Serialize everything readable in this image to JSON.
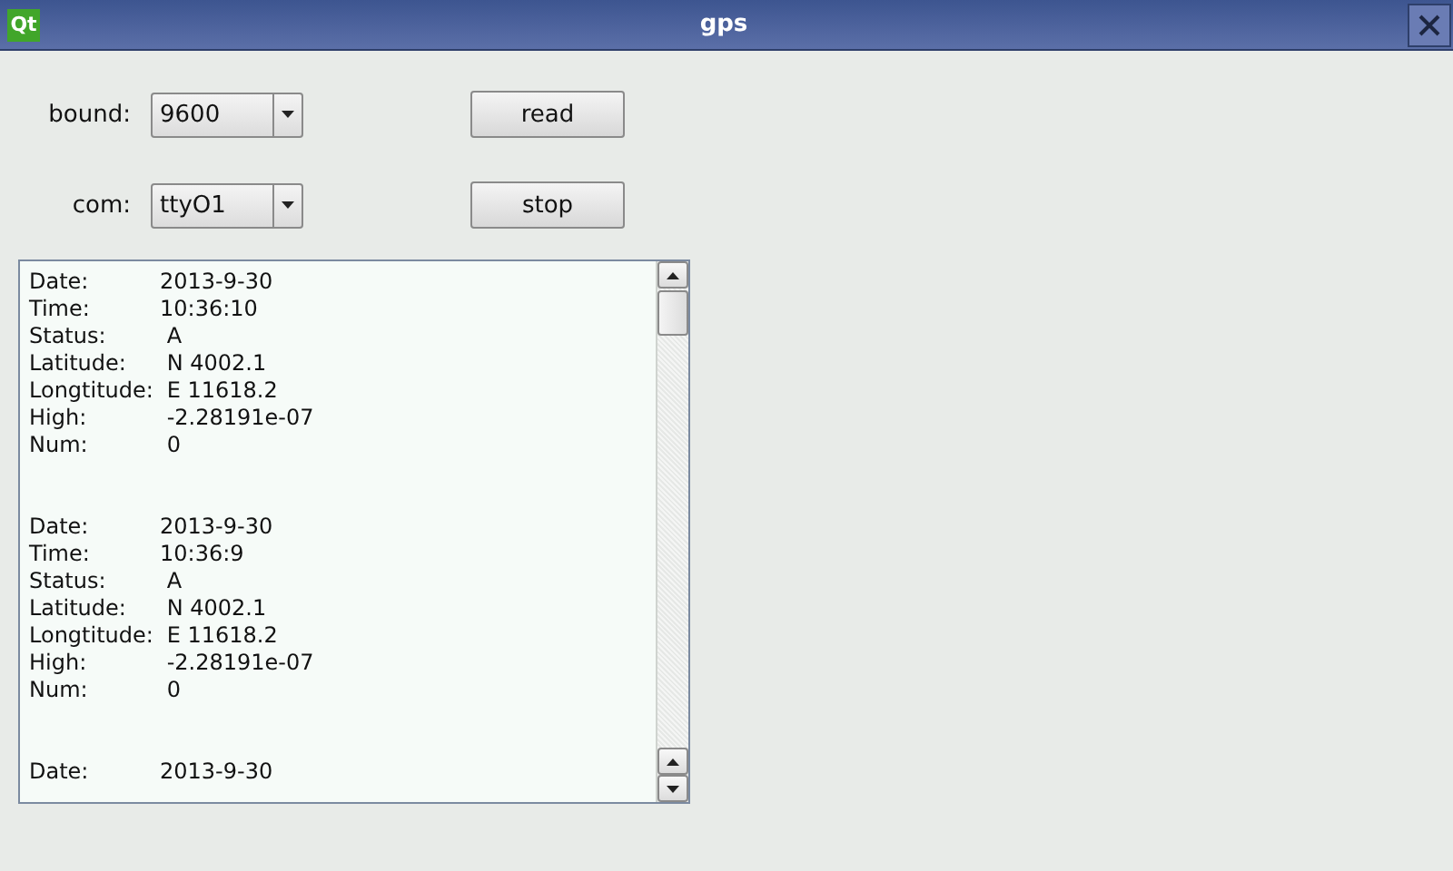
{
  "window": {
    "logo": "Qt",
    "title": "gps"
  },
  "controls": [
    {
      "label": "bound:",
      "value": "9600",
      "button": "read"
    },
    {
      "label": "com:",
      "value": "ttyO1",
      "button": "stop"
    }
  ],
  "log": [
    [
      {
        "label": "Date:",
        "value": "2013-9-30"
      },
      {
        "label": "Time:",
        "value": "10:36:10"
      },
      {
        "label": "Status:",
        "value": " A"
      },
      {
        "label": "Latitude:",
        "value": " N 4002.1"
      },
      {
        "label": "Longtitude:",
        "value": " E 11618.2"
      },
      {
        "label": "High:",
        "value": " -2.28191e-07"
      },
      {
        "label": "Num:",
        "value": " 0"
      }
    ],
    [
      {
        "label": "Date:",
        "value": "2013-9-30"
      },
      {
        "label": "Time:",
        "value": "10:36:9"
      },
      {
        "label": "Status:",
        "value": " A"
      },
      {
        "label": "Latitude:",
        "value": " N 4002.1"
      },
      {
        "label": "Longtitude:",
        "value": " E 11618.2"
      },
      {
        "label": "High:",
        "value": " -2.28191e-07"
      },
      {
        "label": "Num:",
        "value": " 0"
      }
    ],
    [
      {
        "label": "Date:",
        "value": "2013-9-30"
      }
    ]
  ]
}
